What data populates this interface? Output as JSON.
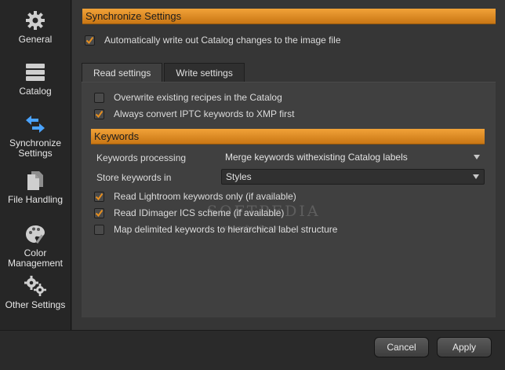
{
  "sidebar": {
    "items": [
      {
        "label": "General",
        "icon": "gear-icon"
      },
      {
        "label": "Catalog",
        "icon": "database-icon"
      },
      {
        "label": "Synchronize\nSettings",
        "icon": "sync-arrows-icon"
      },
      {
        "label": "File Handling",
        "icon": "files-icon"
      },
      {
        "label": "Color\nManagement",
        "icon": "palette-icon"
      },
      {
        "label": "Other Settings",
        "icon": "gears-icon"
      }
    ],
    "active": "Synchronize Settings"
  },
  "colors": {
    "accent": "#e58f21",
    "sync_icon_blue": "#4aa3ff"
  },
  "sync": {
    "header": "Synchronize Settings",
    "auto_write": {
      "label": "Automatically write out Catalog changes to the image file",
      "checked": true
    }
  },
  "tabs": [
    {
      "label": "Read settings",
      "active": true
    },
    {
      "label": "Write settings",
      "active": false
    }
  ],
  "read": {
    "overwrite": {
      "label": "Overwrite existing recipes in the Catalog",
      "checked": false
    },
    "convert_iptc": {
      "label": "Always convert IPTC keywords to XMP first",
      "checked": true
    }
  },
  "keywords": {
    "header": "Keywords",
    "processing_label": "Keywords processing",
    "processing_value": "Merge keywords withexisting Catalog labels",
    "store_label": "Store keywords in",
    "store_value": "Styles",
    "lightroom": {
      "label": "Read Lightroom keywords only (if available)",
      "checked": true
    },
    "idimager": {
      "label": "Read IDimager ICS scheme (if available)",
      "checked": true
    },
    "hierarchical": {
      "label": "Map delimited keywords to hierarchical label structure",
      "checked": false
    }
  },
  "watermark": {
    "text": "SOFTPEDIA",
    "sub": "www.softpedia.com"
  },
  "buttons": {
    "cancel": "Cancel",
    "apply": "Apply"
  }
}
